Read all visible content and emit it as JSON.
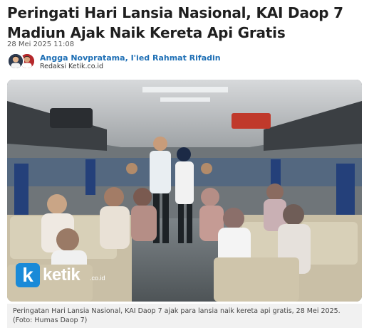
{
  "article": {
    "title": "Peringati Hari Lansia Nasional, KAI Daop 7 Madiun Ajak Naik Kereta Api Gratis",
    "date": "28 Mei 2025 11:08",
    "authors": [
      "Angga Novpratama",
      "I'ied Rahmat Rifadin"
    ],
    "author_separator": ", ",
    "redaksi": "Redaksi Ketik.co.id"
  },
  "photo": {
    "watermark_brand": "ketik",
    "watermark_suffix": ".co.id",
    "watermark_letter": "k",
    "caption": "Peringatan Hari Lansia Nasional, KAI Daop 7 ajak para lansia naik kereta api gratis, 28 Mei 2025. (Foto: Humas Daop 7)"
  },
  "icons": {
    "avatar_1": "author-avatar-icon",
    "avatar_2": "author-avatar-icon"
  },
  "colors": {
    "author_link": "#1e6fb5",
    "watermark_blue": "#1a8ad8",
    "caption_bg": "#f1f1f1"
  }
}
